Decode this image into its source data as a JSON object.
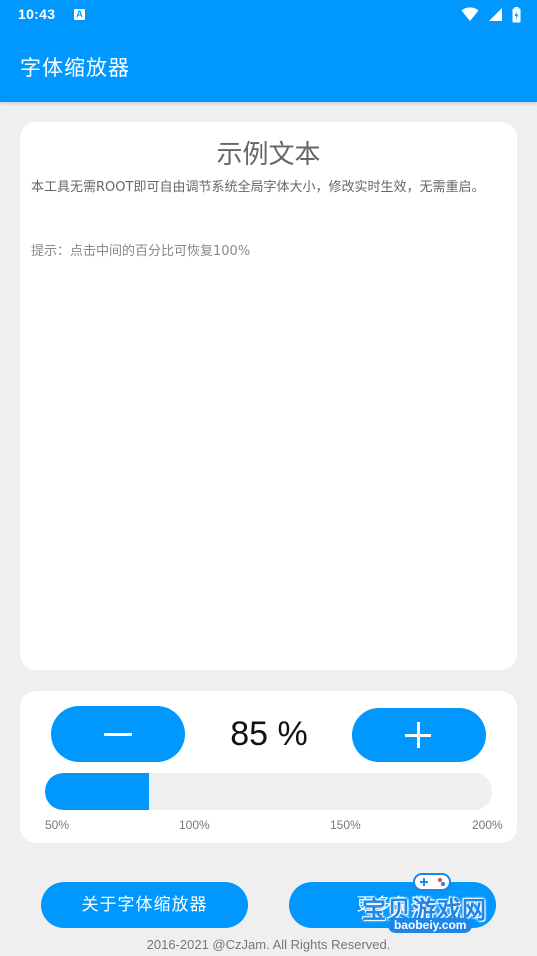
{
  "status_bar": {
    "time": "10:43",
    "notification_badge": "A",
    "icons": [
      "wifi-icon",
      "signal-icon",
      "battery-icon"
    ]
  },
  "app_bar": {
    "title": "字体缩放器"
  },
  "sample": {
    "title": "示例文本",
    "body": "本工具无需ROOT即可自由调节系统全局字体大小，修改实时生效，无需重启。",
    "tip": "提示：点击中间的百分比可恢复100%"
  },
  "scale": {
    "percent_label": "85 %",
    "value_percent": 85,
    "min_percent": 50,
    "max_percent": 200,
    "ticks": [
      "50%",
      "100%",
      "150%",
      "200%"
    ],
    "minus_icon": "minus-icon",
    "plus_icon": "plus-icon"
  },
  "buttons": {
    "about": "关于字体缩放器",
    "more": "更多免费"
  },
  "footer": "2016-2021 @CzJam. All Rights Reserved.",
  "watermark": {
    "text": "宝贝游戏网",
    "url": "baobeiy.com"
  },
  "colors": {
    "primary": "#0098ff",
    "background": "#efefef",
    "card": "#ffffff",
    "track": "#efefef"
  }
}
